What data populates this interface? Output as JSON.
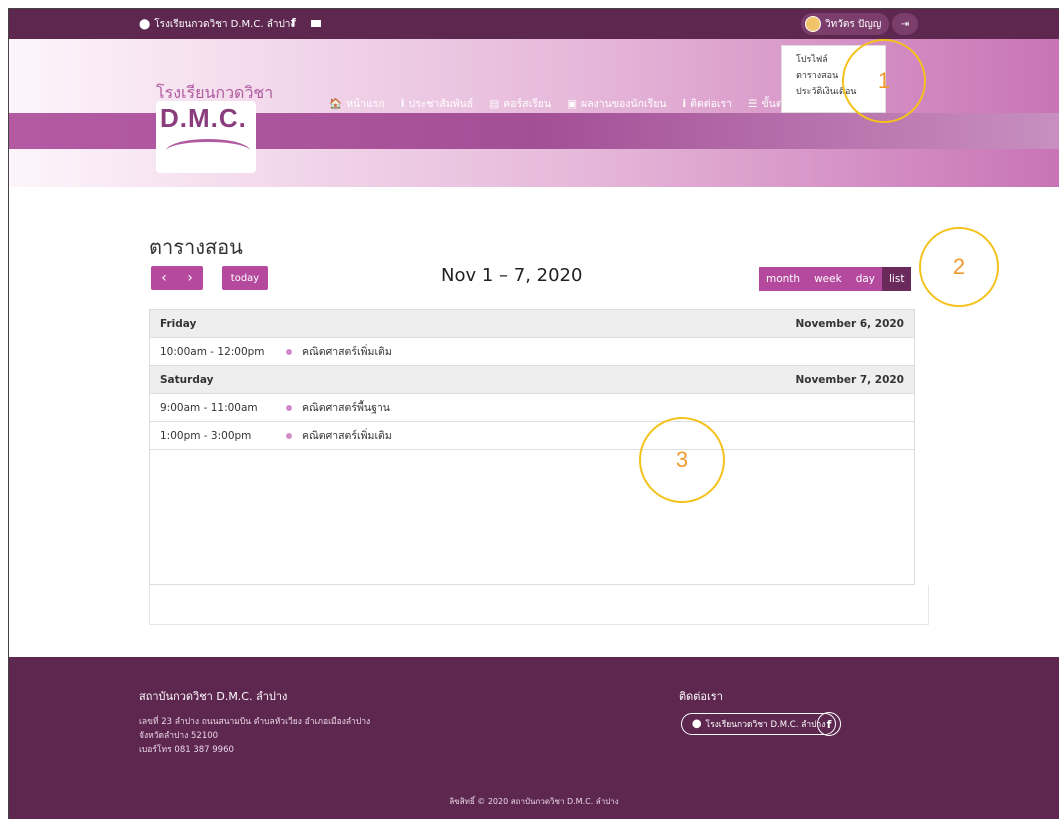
{
  "topbar": {
    "location": "โรงเรียนกวดวิชา D.M.C. ลำปาง",
    "facebook_icon": "f",
    "user_name": "วิทวัตร ปัญญ",
    "logout_icon": "⇥"
  },
  "logo": {
    "line1": "โรงเรียนกวดวิชา",
    "line2": "D.M.C."
  },
  "nav": [
    {
      "icon": "🏠",
      "label": "หน้าแรก"
    },
    {
      "icon": "i",
      "label": "ประชาสัมพันธ์"
    },
    {
      "icon": "▤",
      "label": "คอร์สเรียน"
    },
    {
      "icon": "▣",
      "label": "ผลงานของนักเรียน"
    },
    {
      "icon": "i",
      "label": "ติดต่อเรา"
    },
    {
      "icon": "☰",
      "label": "ขั้นตอนการสมัครเรียน"
    }
  ],
  "dropdown": [
    "โปรไฟล์",
    "ตารางสอน",
    "ประวัติเงินเดือน"
  ],
  "annotations": [
    "1",
    "2",
    "3"
  ],
  "page_title": "ตารางสอน",
  "toolbar": {
    "prev": "‹",
    "next": "›",
    "today": "today",
    "range": "Nov 1 – 7, 2020",
    "views": [
      "month",
      "week",
      "day",
      "list"
    ],
    "active_view": "list"
  },
  "calendar": {
    "days": [
      {
        "day": "Friday",
        "date": "November 6, 2020",
        "events": [
          {
            "time": "10:00am - 12:00pm",
            "title": "คณิตศาสตร์เพิ่มเติม"
          }
        ]
      },
      {
        "day": "Saturday",
        "date": "November 7, 2020",
        "events": [
          {
            "time": "9:00am - 11:00am",
            "title": "คณิตศาสตร์พื้นฐาน"
          },
          {
            "time": "1:00pm - 3:00pm",
            "title": "คณิตศาสตร์เพิ่มเติม"
          }
        ]
      }
    ]
  },
  "footer": {
    "title": "สถาบันกวดวิชา D.M.C. ลำปาง",
    "address": [
      "เลขที่ 23 ลำปาง ถนนสนามบิน ตำบลหัวเวียง อำเภอเมืองลำปาง",
      "จังหวัดลำปาง 52100",
      "เบอร์โทร 081 387 9960"
    ],
    "contact_title": "ติดต่อเรา",
    "contact_pill": "โรงเรียนกวดวิชา D.M.C. ลำปาง",
    "copyright": "ลิขสิทธิ์ © 2020 สถาบันกวดวิชา D.M.C. ลำปาง"
  },
  "colors": {
    "primary": "#b4499d",
    "dark": "#5e2750",
    "active": "#6a2a5c",
    "highlight": "#f5c11b"
  }
}
